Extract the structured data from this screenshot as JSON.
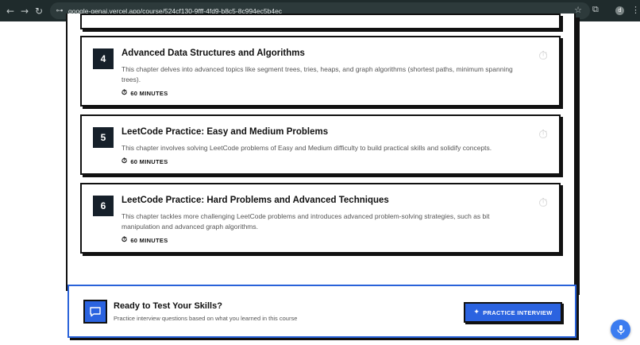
{
  "browser": {
    "url": "google-genai.vercel.app/course/524cf130-9fff-4fd9-b8c5-8c994ec5b4ec",
    "profile_initial": "d",
    "icons": {
      "back": "←",
      "forward": "→",
      "reload": "↻",
      "site": "⊶",
      "star": "☆",
      "extensions": "⧉",
      "menu": "⋮"
    }
  },
  "chapters": [
    {
      "number": "4",
      "title": "Advanced Data Structures and Algorithms",
      "description": "This chapter delves into advanced topics like segment trees, tries, heaps, and graph algorithms (shortest paths, minimum spanning trees).",
      "duration": "60 MINUTES"
    },
    {
      "number": "5",
      "title": "LeetCode Practice: Easy and Medium Problems",
      "description": "This chapter involves solving LeetCode problems of Easy and Medium difficulty to build practical skills and solidify concepts.",
      "duration": "60 MINUTES"
    },
    {
      "number": "6",
      "title": "LeetCode Practice: Hard Problems and Advanced Techniques",
      "description": "This chapter tackles more challenging LeetCode problems and introduces advanced problem-solving strategies, such as bit manipulation and advanced graph algorithms.",
      "duration": "60 MINUTES"
    }
  ],
  "cta": {
    "title": "Ready to Test Your Skills?",
    "subtitle": "Practice interview questions based on what you learned in this course",
    "button_label": "PRACTICE INTERVIEW"
  },
  "colors": {
    "accent": "#2b63e0",
    "number_badge": "#16202a",
    "chrome": "#1f2b2c"
  }
}
